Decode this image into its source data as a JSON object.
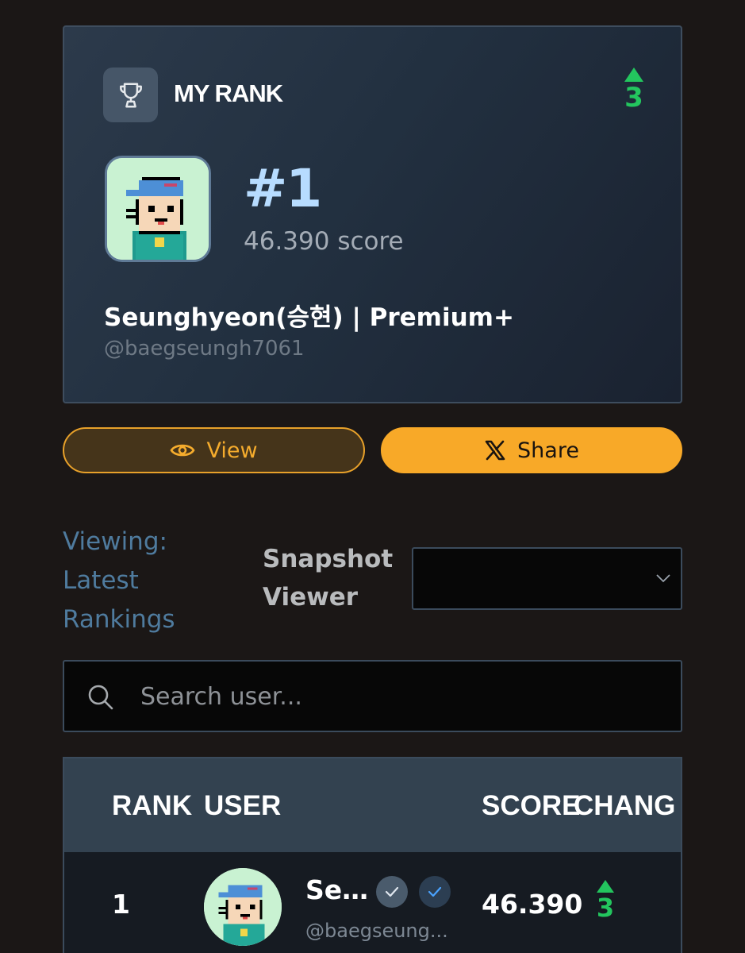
{
  "my_rank": {
    "heading": "MY RANK",
    "rank_change": "3",
    "rank_number": "#1",
    "score_text": "46.390 score",
    "display_name": "Seunghyeon(승현) | Premium+",
    "handle": "@baegseungh7061"
  },
  "actions": {
    "view_label": "View",
    "share_label": "Share"
  },
  "snapshot": {
    "viewing_text": "Viewing: Latest Rankings",
    "viewer_label": "Snapshot Viewer",
    "selected_value": ""
  },
  "search": {
    "placeholder": "Search user..."
  },
  "table": {
    "headers": {
      "rank": "RANK",
      "user": "USER",
      "score": "SCORE",
      "change": "CHANG"
    },
    "rows": [
      {
        "rank": "1",
        "name": "Se...",
        "handle": "@baegseung...",
        "score": "46.390",
        "change": "3"
      }
    ]
  },
  "colors": {
    "accent_orange": "#f8a928",
    "positive_green": "#23c55e",
    "rank_blue": "#b7dcff"
  }
}
